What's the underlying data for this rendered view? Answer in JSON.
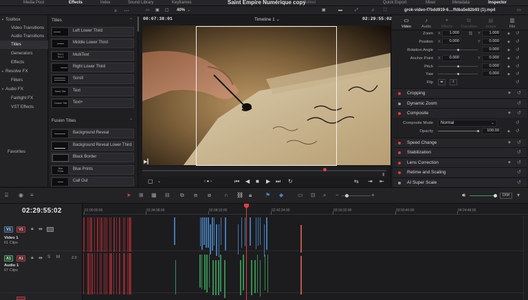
{
  "app": {
    "project_title": "Saint Empire Numérique copy",
    "edited_label": "Edited"
  },
  "topbar": {
    "media_pool": "Media Pool",
    "effects": "Effects",
    "index": "Index",
    "sound_library": "Sound Library",
    "keyframes": "Keyframes",
    "quick_export": "Quick Export",
    "mixer": "Mixer",
    "metadata": "Metadata",
    "inspector": "Inspector"
  },
  "viewer": {
    "zoom": "40%",
    "timecode_left": "00:07:38:01",
    "timeline_name": "Timeline 1",
    "timecode_right": "02:29:55:02",
    "clip_name": "grok-video-f7bdd919-6....ffdba5e82b93 (1).mp4"
  },
  "toolbox": {
    "header": "Toolbox",
    "items": [
      {
        "label": "Video Transitions",
        "indent": true
      },
      {
        "label": "Audio Transitions",
        "indent": true
      },
      {
        "label": "Titles",
        "indent": false,
        "selected": true
      },
      {
        "label": "Generators",
        "indent": true
      },
      {
        "label": "Effects",
        "indent": true
      },
      {
        "label": "Resolve FX",
        "indent": false
      },
      {
        "label": "Filters",
        "indent": true
      },
      {
        "label": "Audio FX",
        "indent": false
      },
      {
        "label": "Fairlight FX",
        "indent": true
      },
      {
        "label": "VST Effects",
        "indent": true
      }
    ],
    "favorites": "Favorites"
  },
  "titles_panel": {
    "header": "Titles",
    "items": [
      "Left Lower Third",
      "Middle Lower Third",
      "MultiText",
      "Right Lower Third",
      "Scroll",
      "Text",
      "Text+"
    ],
    "fusion_header": "Fusion Titles",
    "fusion_items": [
      "Background Reveal",
      "Background Reveal Lower Third",
      "Black Border",
      "Blue Prints",
      "Call Out"
    ],
    "thumb_texts": {
      "multitext": "Text 1\nText 2",
      "text": "Basic Title",
      "textplus": "Custom Title",
      "blue_prints": "Blue\nPrints"
    }
  },
  "inspector": {
    "tabs": [
      "Video",
      "Audio",
      "Effects",
      "Transition",
      "Image",
      "File"
    ],
    "params": [
      {
        "label": "Zoom",
        "axes": [
          "X",
          "Y"
        ],
        "values": [
          "1.000",
          "1.000"
        ]
      },
      {
        "label": "Position",
        "axes": [
          "X",
          "Y"
        ],
        "values": [
          "0.000",
          "0.000"
        ]
      },
      {
        "label": "Rotation Angle",
        "axes": [],
        "values": [
          "0.000"
        ]
      },
      {
        "label": "Anchor Point",
        "axes": [
          "X",
          "Y"
        ],
        "values": [
          "0.000",
          "0.000"
        ]
      },
      {
        "label": "Pitch",
        "axes": [],
        "values": [
          "0.000"
        ]
      },
      {
        "label": "Yaw",
        "axes": [],
        "values": [
          "0.000"
        ]
      },
      {
        "label": "Flip",
        "axes": [],
        "values": []
      }
    ],
    "sections": [
      {
        "label": "Cropping",
        "dot": "#e04040"
      },
      {
        "label": "Dynamic Zoom",
        "dot": "#9a9a9a"
      },
      {
        "label": "Composite",
        "dot": "#e04040"
      },
      {
        "label": "Speed Change",
        "dot": "#e04040"
      },
      {
        "label": "Stabilization",
        "dot": "#e04040"
      },
      {
        "label": "Lens Correction",
        "dot": "#e04040"
      },
      {
        "label": "Retime and Scaling",
        "dot": "#e04040"
      },
      {
        "label": "AI Super Scale",
        "dot": "#9a9a9a"
      }
    ],
    "composite_mode_label": "Composite Mode",
    "composite_mode_value": "Normal",
    "opacity_label": "Opacity",
    "opacity_value": "100.00"
  },
  "timeline": {
    "timecode": "02:29:55:02",
    "ruler": [
      "01:00:00:00",
      "01:34:08:00",
      "02:08:16:00",
      "02:42:24:00",
      "03:16:32:00",
      "03:50:40:00",
      "04:24:48:00"
    ],
    "tracks": [
      {
        "badge": "V1",
        "name": "Video 1",
        "clips": "61 Clips"
      },
      {
        "badge": "A1",
        "name": "Audio 1",
        "clips": "67 Clips",
        "level": "2.0"
      }
    ],
    "dim_label": "DIM"
  },
  "colors": {
    "accent": "#e04040",
    "video_clip": "#4a84c0",
    "audio_clip": "#3c9a58",
    "marker_red": "#9a2a30"
  }
}
